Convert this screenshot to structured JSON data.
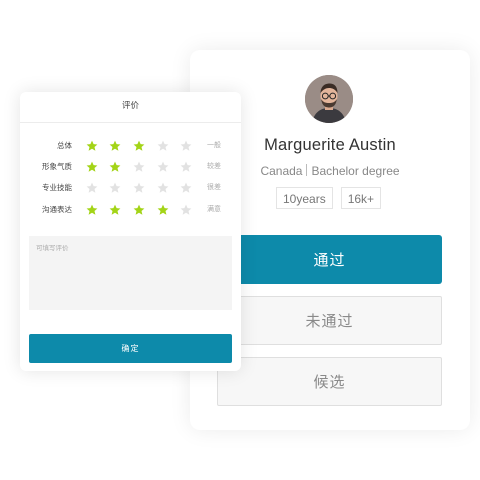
{
  "evaluation": {
    "title": "评价",
    "comment_placeholder": "可填写评价",
    "comment_value": "",
    "confirm_label": "确定",
    "max_stars": 5,
    "ratings": [
      {
        "label": "总体",
        "stars": 3,
        "text": "一般"
      },
      {
        "label": "形象气质",
        "stars": 2,
        "text": "较差"
      },
      {
        "label": "专业技能",
        "stars": 0,
        "text": "很差"
      },
      {
        "label": "沟通表达",
        "stars": 4,
        "text": "满意"
      }
    ]
  },
  "candidate": {
    "name": "Marguerite Austin",
    "location": "Canada",
    "education": "Bachelor degree",
    "tags": [
      "10years",
      "16k+"
    ]
  },
  "actions": {
    "pass": "通过",
    "fail": "未通过",
    "standby": "候选"
  },
  "colors": {
    "accent": "#0d8aaa",
    "star_filled": "#a3d417",
    "star_empty": "#e2e2e2"
  },
  "icons": {
    "star": "star-icon",
    "avatar": "user-photo-avatar"
  }
}
